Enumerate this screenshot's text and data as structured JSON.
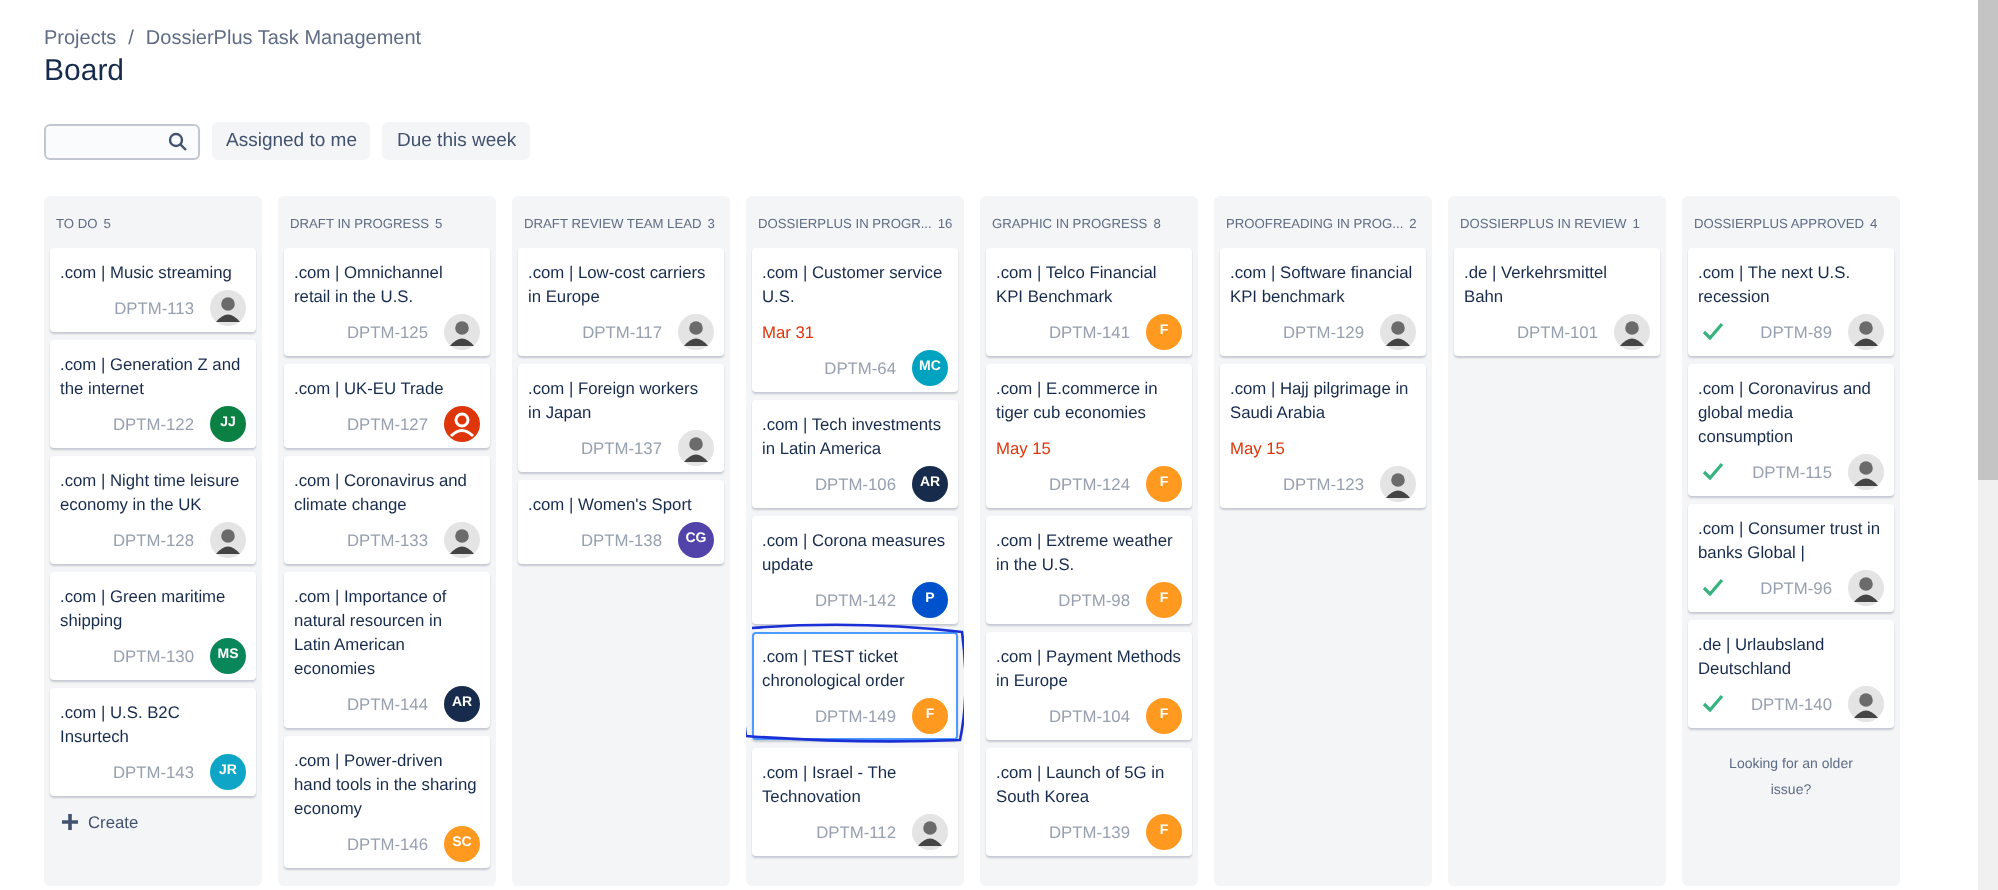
{
  "breadcrumbs": [
    "Projects",
    "DossierPlus Task Management"
  ],
  "breadcrumb_separator": "/",
  "title": "Board",
  "filters": {
    "buttons": [
      "Assigned to me",
      "Due this week"
    ]
  },
  "columns": [
    {
      "title": "TO DO",
      "count": "5",
      "create_label": "Create",
      "cards": [
        {
          "title": ".com | Music streaming",
          "key": "DPTM-113",
          "done": false,
          "selected": false,
          "avatar": {
            "kind": "photo"
          }
        },
        {
          "title": ".com | Generation Z and the internet",
          "key": "DPTM-122",
          "done": false,
          "selected": false,
          "avatar": {
            "kind": "initials",
            "initials": "JJ",
            "color": "#0b8043"
          }
        },
        {
          "title": ".com | Night time leisure economy in the UK",
          "key": "DPTM-128",
          "done": false,
          "selected": false,
          "avatar": {
            "kind": "photo"
          }
        },
        {
          "title": ".com | Green maritime shipping",
          "key": "DPTM-130",
          "done": false,
          "selected": false,
          "avatar": {
            "kind": "initials",
            "initials": "MS",
            "color": "#0a875a"
          }
        },
        {
          "title": ".com | U.S. B2C Insurtech",
          "key": "DPTM-143",
          "done": false,
          "selected": false,
          "avatar": {
            "kind": "initials",
            "initials": "JR",
            "color": "#0ea5c7"
          }
        }
      ]
    },
    {
      "title": "DRAFT IN PROGRESS",
      "count": "5",
      "cards": [
        {
          "title": ".com | Omnichannel retail in the U.S.",
          "key": "DPTM-125",
          "done": false,
          "selected": false,
          "avatar": {
            "kind": "photo"
          }
        },
        {
          "title": ".com | UK-EU Trade",
          "key": "DPTM-127",
          "done": false,
          "selected": false,
          "avatar": {
            "kind": "default",
            "color": "#de350b"
          }
        },
        {
          "title": ".com | Coronavirus and climate change",
          "key": "DPTM-133",
          "done": false,
          "selected": false,
          "avatar": {
            "kind": "photo"
          }
        },
        {
          "title": ".com | Importance of natural resourcen in Latin American economies",
          "key": "DPTM-144",
          "done": false,
          "selected": false,
          "avatar": {
            "kind": "initials",
            "initials": "AR",
            "color": "#172b4d"
          }
        },
        {
          "title": ".com | Power-driven hand tools in the sharing economy",
          "key": "DPTM-146",
          "done": false,
          "selected": false,
          "avatar": {
            "kind": "initials",
            "initials": "SC",
            "color": "#ff991f"
          }
        }
      ]
    },
    {
      "title": "DRAFT REVIEW TEAM LEAD",
      "count": "3",
      "cards": [
        {
          "title": ".com | Low-cost carriers in Europe",
          "key": "DPTM-117",
          "done": false,
          "selected": false,
          "avatar": {
            "kind": "photo"
          }
        },
        {
          "title": ".com | Foreign workers in Japan",
          "key": "DPTM-137",
          "done": false,
          "selected": false,
          "avatar": {
            "kind": "photo"
          }
        },
        {
          "title": ".com | Women's Sport",
          "key": "DPTM-138",
          "done": false,
          "selected": false,
          "avatar": {
            "kind": "initials",
            "initials": "CG",
            "color": "#5243aa"
          }
        }
      ]
    },
    {
      "title": "DOSSIERPLUS IN PROGR...",
      "count": "16",
      "cards": [
        {
          "title": ".com | Customer service U.S.",
          "due": "Mar 31",
          "key": "DPTM-64",
          "done": false,
          "selected": false,
          "avatar": {
            "kind": "initials",
            "initials": "MC",
            "color": "#00a3bf"
          }
        },
        {
          "title": ".com | Tech investments in Latin America",
          "key": "DPTM-106",
          "done": false,
          "selected": false,
          "avatar": {
            "kind": "initials",
            "initials": "AR",
            "color": "#172b4d"
          }
        },
        {
          "title": ".com | Corona measures update",
          "key": "DPTM-142",
          "done": false,
          "selected": false,
          "avatar": {
            "kind": "initials",
            "initials": "P",
            "color": "#0052cc"
          }
        },
        {
          "title": ".com | TEST ticket chronological order",
          "key": "DPTM-149",
          "done": false,
          "selected": true,
          "avatar": {
            "kind": "initials",
            "initials": "F",
            "color": "#ff991f"
          }
        },
        {
          "title": ".com | Israel - The Technovation",
          "key": "DPTM-112",
          "done": false,
          "selected": false,
          "avatar": {
            "kind": "photo"
          }
        }
      ]
    },
    {
      "title": "GRAPHIC IN PROGRESS",
      "count": "8",
      "cards": [
        {
          "title": ".com | Telco Financial KPI Benchmark",
          "key": "DPTM-141",
          "done": false,
          "selected": false,
          "avatar": {
            "kind": "initials",
            "initials": "F",
            "color": "#ff991f"
          }
        },
        {
          "title": ".com | E.commerce in tiger cub economies",
          "due": "May 15",
          "key": "DPTM-124",
          "done": false,
          "selected": false,
          "avatar": {
            "kind": "initials",
            "initials": "F",
            "color": "#ff991f"
          }
        },
        {
          "title": ".com | Extreme weather in the U.S.",
          "key": "DPTM-98",
          "done": false,
          "selected": false,
          "avatar": {
            "kind": "initials",
            "initials": "F",
            "color": "#ff991f"
          }
        },
        {
          "title": ".com | Payment Methods in Europe",
          "key": "DPTM-104",
          "done": false,
          "selected": false,
          "avatar": {
            "kind": "initials",
            "initials": "F",
            "color": "#ff991f"
          }
        },
        {
          "title": ".com | Launch of 5G in South Korea",
          "key": "DPTM-139",
          "done": false,
          "selected": false,
          "avatar": {
            "kind": "initials",
            "initials": "F",
            "color": "#ff991f"
          }
        }
      ]
    },
    {
      "title": "PROOFREADING IN PROG...",
      "count": "2",
      "cards": [
        {
          "title": ".com | Software financial KPI benchmark",
          "key": "DPTM-129",
          "done": false,
          "selected": false,
          "avatar": {
            "kind": "photo"
          }
        },
        {
          "title": ".com | Hajj pilgrimage in Saudi Arabia",
          "due": "May 15",
          "key": "DPTM-123",
          "done": false,
          "selected": false,
          "avatar": {
            "kind": "photo"
          }
        }
      ]
    },
    {
      "title": "DOSSIERPLUS IN REVIEW",
      "count": "1",
      "cards": [
        {
          "title": ".de | Verkehrsmittel Bahn",
          "key": "DPTM-101",
          "done": false,
          "selected": false,
          "avatar": {
            "kind": "photo"
          }
        }
      ]
    },
    {
      "title": "DOSSIERPLUS APPROVED",
      "count": "4",
      "footer_note": "Looking for an older issue?",
      "cards": [
        {
          "title": ".com | The next U.S. recession",
          "key": "DPTM-89",
          "done": true,
          "selected": false,
          "avatar": {
            "kind": "photo"
          }
        },
        {
          "title": ".com | Coronavirus and global media consumption",
          "key": "DPTM-115",
          "done": true,
          "selected": false,
          "avatar": {
            "kind": "photo"
          }
        },
        {
          "title": ".com | Consumer trust in banks Global |",
          "key": "DPTM-96",
          "done": true,
          "selected": false,
          "avatar": {
            "kind": "photo"
          }
        },
        {
          "title": ".de | Urlaubsland Deutschland",
          "key": "DPTM-140",
          "done": true,
          "selected": false,
          "avatar": {
            "kind": "photo"
          }
        }
      ]
    }
  ]
}
